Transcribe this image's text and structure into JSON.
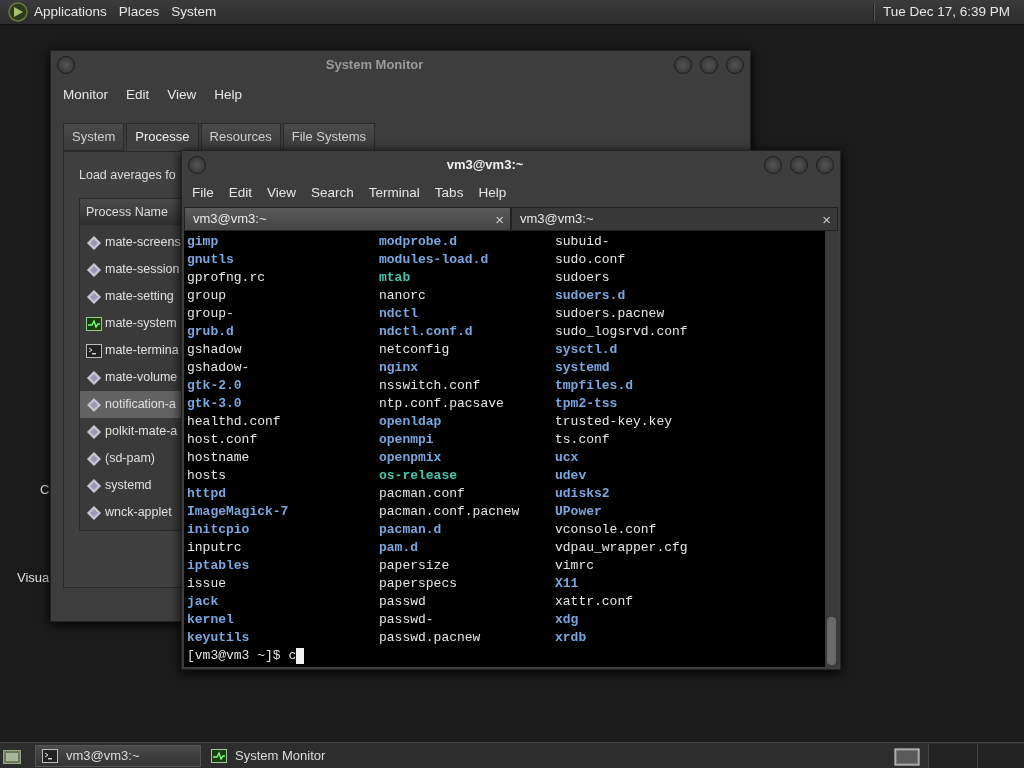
{
  "top_panel": {
    "menus": [
      "Applications",
      "Places",
      "System"
    ],
    "clock": "Tue Dec 17, 6:39 PM"
  },
  "desktop_icons": [
    {
      "label": "C"
    },
    {
      "label": "Visua"
    }
  ],
  "system_monitor": {
    "title": "System Monitor",
    "menus": [
      "Monitor",
      "Edit",
      "View",
      "Help"
    ],
    "tabs": [
      {
        "label": "System",
        "selected": false
      },
      {
        "label": "Processe",
        "selected": true
      },
      {
        "label": "Resources",
        "selected": false
      },
      {
        "label": "File Systems",
        "selected": false
      }
    ],
    "load_label": "Load averages fo",
    "column": "Process Name",
    "processes": [
      {
        "name": "mate-screens",
        "kind": "daemon",
        "selected": false
      },
      {
        "name": "mate-session",
        "kind": "daemon",
        "selected": false
      },
      {
        "name": "mate-setting",
        "kind": "daemon",
        "selected": false
      },
      {
        "name": "mate-system",
        "kind": "monitor",
        "selected": false
      },
      {
        "name": "mate-termina",
        "kind": "terminal",
        "selected": false
      },
      {
        "name": "mate-volume",
        "kind": "daemon",
        "selected": false
      },
      {
        "name": "notification-a",
        "kind": "daemon",
        "selected": true
      },
      {
        "name": "polkit-mate-a",
        "kind": "daemon",
        "selected": false
      },
      {
        "name": "(sd-pam)",
        "kind": "daemon",
        "selected": false
      },
      {
        "name": "systemd",
        "kind": "daemon",
        "selected": false
      },
      {
        "name": "wnck-applet",
        "kind": "daemon",
        "selected": false
      }
    ]
  },
  "terminal": {
    "title": "vm3@vm3:~",
    "menus": [
      "File",
      "Edit",
      "View",
      "Search",
      "Terminal",
      "Tabs",
      "Help"
    ],
    "tabs": [
      {
        "label": "vm3@vm3:~",
        "close": "×",
        "selected": true
      },
      {
        "label": "vm3@vm3:~",
        "close": "×",
        "selected": false
      }
    ],
    "listing": [
      [
        {
          "name": "gimp",
          "kind": "dir"
        },
        {
          "name": "gnutls",
          "kind": "dir"
        },
        {
          "name": "gprofng.rc",
          "kind": "file"
        },
        {
          "name": "group",
          "kind": "file"
        },
        {
          "name": "group-",
          "kind": "file"
        },
        {
          "name": "grub.d",
          "kind": "dir"
        },
        {
          "name": "gshadow",
          "kind": "file"
        },
        {
          "name": "gshadow-",
          "kind": "file"
        },
        {
          "name": "gtk-2.0",
          "kind": "dir"
        },
        {
          "name": "gtk-3.0",
          "kind": "dir"
        },
        {
          "name": "healthd.conf",
          "kind": "file"
        },
        {
          "name": "host.conf",
          "kind": "file"
        },
        {
          "name": "hostname",
          "kind": "file"
        },
        {
          "name": "hosts",
          "kind": "file"
        },
        {
          "name": "httpd",
          "kind": "dir"
        },
        {
          "name": "ImageMagick-7",
          "kind": "dir"
        },
        {
          "name": "initcpio",
          "kind": "dir"
        },
        {
          "name": "inputrc",
          "kind": "file"
        },
        {
          "name": "iptables",
          "kind": "dir"
        },
        {
          "name": "issue",
          "kind": "file"
        },
        {
          "name": "jack",
          "kind": "dir"
        },
        {
          "name": "kernel",
          "kind": "dir"
        },
        {
          "name": "keyutils",
          "kind": "dir"
        }
      ],
      [
        {
          "name": "modprobe.d",
          "kind": "dir"
        },
        {
          "name": "modules-load.d",
          "kind": "dir"
        },
        {
          "name": "mtab",
          "kind": "link"
        },
        {
          "name": "nanorc",
          "kind": "file"
        },
        {
          "name": "ndctl",
          "kind": "dir"
        },
        {
          "name": "ndctl.conf.d",
          "kind": "dir"
        },
        {
          "name": "netconfig",
          "kind": "file"
        },
        {
          "name": "nginx",
          "kind": "dir"
        },
        {
          "name": "nsswitch.conf",
          "kind": "file"
        },
        {
          "name": "ntp.conf.pacsave",
          "kind": "file"
        },
        {
          "name": "openldap",
          "kind": "dir"
        },
        {
          "name": "openmpi",
          "kind": "dir"
        },
        {
          "name": "openpmix",
          "kind": "dir"
        },
        {
          "name": "os-release",
          "kind": "link"
        },
        {
          "name": "pacman.conf",
          "kind": "file"
        },
        {
          "name": "pacman.conf.pacnew",
          "kind": "file"
        },
        {
          "name": "pacman.d",
          "kind": "dir"
        },
        {
          "name": "pam.d",
          "kind": "dir"
        },
        {
          "name": "papersize",
          "kind": "file"
        },
        {
          "name": "paperspecs",
          "kind": "file"
        },
        {
          "name": "passwd",
          "kind": "file"
        },
        {
          "name": "passwd-",
          "kind": "file"
        },
        {
          "name": "passwd.pacnew",
          "kind": "file"
        }
      ],
      [
        {
          "name": "subuid-",
          "kind": "file"
        },
        {
          "name": "sudo.conf",
          "kind": "file"
        },
        {
          "name": "sudoers",
          "kind": "file"
        },
        {
          "name": "sudoers.d",
          "kind": "dir"
        },
        {
          "name": "sudoers.pacnew",
          "kind": "file"
        },
        {
          "name": "sudo_logsrvd.conf",
          "kind": "file"
        },
        {
          "name": "sysctl.d",
          "kind": "dir"
        },
        {
          "name": "systemd",
          "kind": "dir"
        },
        {
          "name": "tmpfiles.d",
          "kind": "dir"
        },
        {
          "name": "tpm2-tss",
          "kind": "dir"
        },
        {
          "name": "trusted-key.key",
          "kind": "file"
        },
        {
          "name": "ts.conf",
          "kind": "file"
        },
        {
          "name": "ucx",
          "kind": "dir"
        },
        {
          "name": "udev",
          "kind": "dir"
        },
        {
          "name": "udisks2",
          "kind": "dir"
        },
        {
          "name": "UPower",
          "kind": "dir"
        },
        {
          "name": "vconsole.conf",
          "kind": "file"
        },
        {
          "name": "vdpau_wrapper.cfg",
          "kind": "file"
        },
        {
          "name": "vimrc",
          "kind": "file"
        },
        {
          "name": "X11",
          "kind": "dir"
        },
        {
          "name": "xattr.conf",
          "kind": "file"
        },
        {
          "name": "xdg",
          "kind": "dir"
        },
        {
          "name": "xrdb",
          "kind": "dir"
        }
      ]
    ],
    "prompt": "[vm3@vm3 ~]$ c"
  },
  "taskbar": {
    "tasks": [
      {
        "label": "vm3@vm3:~",
        "kind": "terminal",
        "selected": true
      },
      {
        "label": "System Monitor",
        "kind": "monitor",
        "selected": false
      }
    ]
  }
}
